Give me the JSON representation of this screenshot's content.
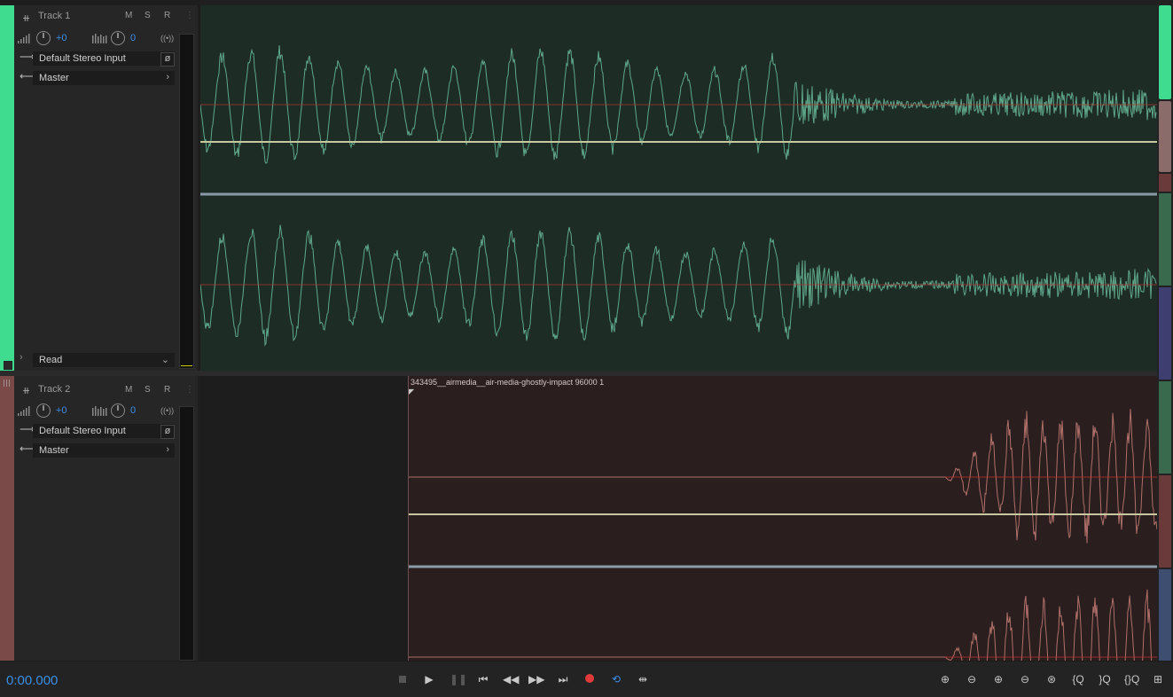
{
  "tracks": [
    {
      "name": "Track 1",
      "m": "M",
      "s": "S",
      "r": "R",
      "volume": "+0",
      "pan": "0",
      "input": "Default Stereo Input",
      "output": "Master",
      "automation": "Read",
      "color": "#3fdc8f",
      "waveform_color": "#5fa78a",
      "lane_bg": "#1d2d26"
    },
    {
      "name": "Track 2",
      "m": "M",
      "s": "S",
      "r": "R",
      "volume": "+0",
      "pan": "0",
      "input": "Default Stereo Input",
      "output": "Master",
      "color": "#7a4a48",
      "waveform_color": "#b0706a",
      "lane_bg": "#2a1e1e"
    }
  ],
  "clip": {
    "title": "343495__airmedia__air-media-ghostly-impact 96000 1"
  },
  "transport": {
    "time": "0:00.000",
    "buttons": [
      "stop",
      "play",
      "pause",
      "go-to-start",
      "rewind",
      "fast-forward",
      "go-to-end",
      "record",
      "loop",
      "skip-selection"
    ]
  },
  "zoom": {
    "buttons": [
      "zoom-in-amplitude",
      "zoom-out-amplitude",
      "zoom-in-time",
      "zoom-out-time",
      "zoom-full",
      "zoom-in-point",
      "zoom-out-point",
      "zoom-full-point",
      "zoom-selection"
    ]
  },
  "colors": {
    "accent": "#3a8ee6",
    "record": "#e03a3a"
  }
}
